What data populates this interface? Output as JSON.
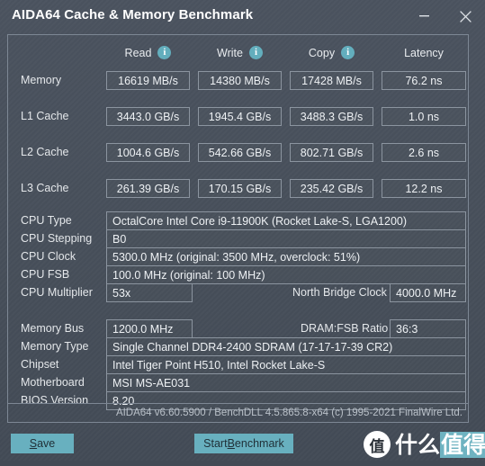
{
  "window": {
    "title": "AIDA64 Cache & Memory Benchmark",
    "minimize_label": "–",
    "close_label": "✕"
  },
  "benchmark": {
    "columns": [
      {
        "label": "Read",
        "has_info_icon": true,
        "icon": "info-icon"
      },
      {
        "label": "Write",
        "has_info_icon": true,
        "icon": "info-icon"
      },
      {
        "label": "Copy",
        "has_info_icon": true,
        "icon": "info-icon"
      },
      {
        "label": "Latency",
        "has_info_icon": false,
        "icon": ""
      }
    ],
    "rows": [
      {
        "label": "Memory",
        "read": "16619 MB/s",
        "write": "14380 MB/s",
        "copy": "17428 MB/s",
        "latency": "76.2 ns"
      },
      {
        "label": "L1 Cache",
        "read": "3443.0 GB/s",
        "write": "1945.4 GB/s",
        "copy": "3488.3 GB/s",
        "latency": "1.0 ns"
      },
      {
        "label": "L2 Cache",
        "read": "1004.6 GB/s",
        "write": "542.66 GB/s",
        "copy": "802.71 GB/s",
        "latency": "2.6 ns"
      },
      {
        "label": "L3 Cache",
        "read": "261.39 GB/s",
        "write": "170.15 GB/s",
        "copy": "235.42 GB/s",
        "latency": "12.2 ns"
      }
    ]
  },
  "cpu_info": {
    "type_label": "CPU Type",
    "type_value": "OctalCore Intel Core i9-11900K  (Rocket Lake-S, LGA1200)",
    "stepping_label": "CPU Stepping",
    "stepping_value": "B0",
    "clock_label": "CPU Clock",
    "clock_value": "5300.0 MHz  (original: 3500 MHz, overclock: 51%)",
    "fsb_label": "CPU FSB",
    "fsb_value": "100.0 MHz  (original: 100 MHz)",
    "multiplier_label": "CPU Multiplier",
    "multiplier_value": "53x",
    "north_bridge_label": "North Bridge Clock",
    "north_bridge_value": "4000.0 MHz"
  },
  "memory_info": {
    "bus_label": "Memory Bus",
    "bus_value": "1200.0 MHz",
    "ratio_label": "DRAM:FSB Ratio",
    "ratio_value": "36:3",
    "type_label": "Memory Type",
    "type_value": "Single Channel DDR4-2400 SDRAM  (17-17-17-39 CR2)",
    "chipset_label": "Chipset",
    "chipset_value": "Intel Tiger Point H510, Intel Rocket Lake-S",
    "motherboard_label": "Motherboard",
    "motherboard_value": "MSI MS-AE031",
    "bios_label": "BIOS Version",
    "bios_value": "8.20"
  },
  "status": {
    "text": "AIDA64 v6.60.5900 / BenchDLL 4.5.865.8-x64  (c) 1995-2021 FinalWire Ltd."
  },
  "footer": {
    "save_prefix": "S",
    "save_suffix": "ave",
    "benchmark_prefix": "Start ",
    "benchmark_accel": "B",
    "benchmark_suffix": "enchmark"
  },
  "watermark": {
    "logo_char": "值",
    "text_plain": "什么",
    "text_highlight": "值得买"
  },
  "colors": {
    "window_bg": "#4a525e",
    "accent_teal": "#68b0bf",
    "border": "#8b949f",
    "text": "#e8eaed"
  }
}
